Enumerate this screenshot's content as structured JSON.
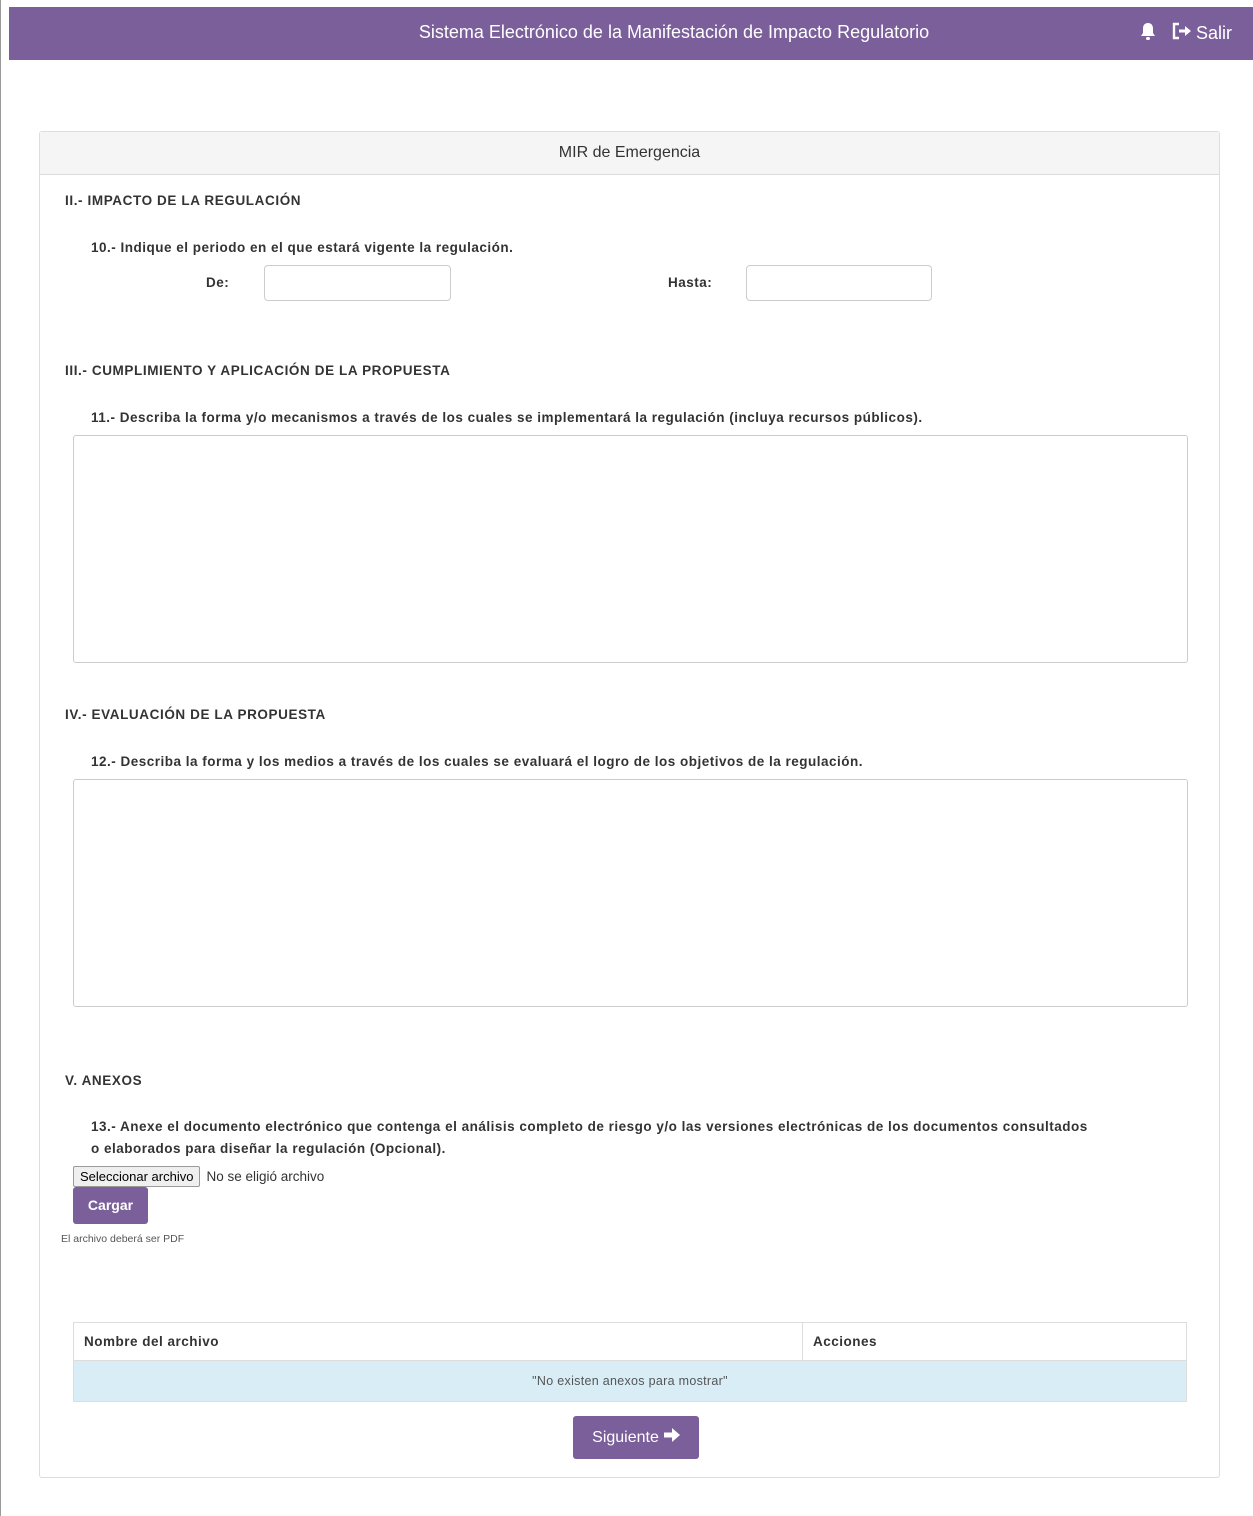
{
  "header": {
    "title": "Sistema Electrónico de la Manifestación de Impacto Regulatorio",
    "logout_label": "Salir",
    "icons": [
      "bell-icon",
      "logout-icon"
    ]
  },
  "card": {
    "title": "MIR de Emergencia"
  },
  "section2": {
    "title": "II.- IMPACTO DE LA REGULACIÓN",
    "question": "10.- Indique el periodo en el que estará vigente la regulación.",
    "from_label": "De:",
    "to_label": "Hasta:",
    "from_value": "",
    "to_value": ""
  },
  "section3": {
    "title": "III.- CUMPLIMIENTO Y APLICACIÓN DE LA PROPUESTA",
    "question": "11.- Describa la forma y/o mecanismos a través de los cuales se implementará la regulación (incluya recursos públicos).",
    "value": ""
  },
  "section4": {
    "title": "IV.- EVALUACIÓN DE LA PROPUESTA",
    "question": "12.- Describa la forma y los medios a través de los cuales se evaluará el logro de los objetivos de la regulación.",
    "value": ""
  },
  "section5": {
    "title": "V. ANEXOS",
    "question_line1": "13.- Anexe el documento electrónico que contenga el análisis completo de riesgo y/o las versiones electrónicas de los documentos consultados",
    "question_line2": "o elaborados para diseñar la regulación (Opcional).",
    "file_button": "Seleccionar archivo",
    "file_status": "No se eligió archivo",
    "upload_button": "Cargar",
    "hint": "El archivo deberá ser PDF"
  },
  "annex_table": {
    "columns": [
      "Nombre del archivo",
      "Acciones"
    ],
    "empty_message": "\"No existen anexos para mostrar\""
  },
  "footer": {
    "next_button": "Siguiente"
  },
  "colors": {
    "brand": "#7b5f9a",
    "table_empty_row": "#d9edf7"
  }
}
